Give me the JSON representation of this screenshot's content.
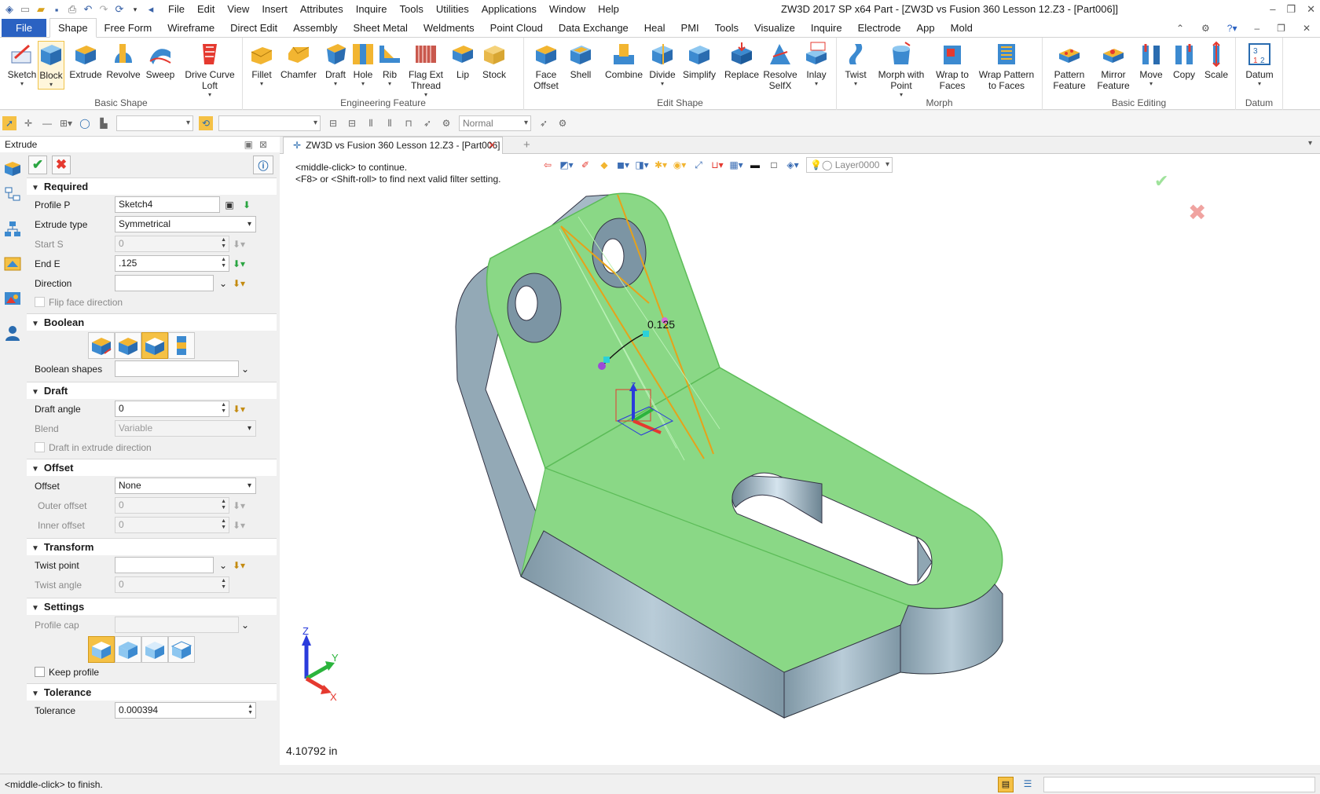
{
  "title_bar": {
    "menus": [
      "File",
      "Edit",
      "View",
      "Insert",
      "Attributes",
      "Inquire",
      "Tools",
      "Utilities",
      "Applications",
      "Window",
      "Help"
    ],
    "window_title": "ZW3D 2017 SP x64        Part - [ZW3D vs Fusion 360 Lesson 12.Z3 - [Part006]]"
  },
  "ribbon_tabs": [
    "Shape",
    "Free Form",
    "Wireframe",
    "Direct Edit",
    "Assembly",
    "Sheet Metal",
    "Weldments",
    "Point Cloud",
    "Data Exchange",
    "Heal",
    "PMI",
    "Tools",
    "Visualize",
    "Inquire",
    "Electrode",
    "App",
    "Mold"
  ],
  "file_tab": "File",
  "ribbon_groups": {
    "basic_shape": {
      "label": "Basic Shape",
      "buttons": [
        {
          "l1": "Sketch",
          "l2": ""
        },
        {
          "l1": "Block",
          "l2": ""
        },
        {
          "l1": "Extrude",
          "l2": ""
        },
        {
          "l1": "Revolve",
          "l2": ""
        },
        {
          "l1": "Sweep",
          "l2": ""
        },
        {
          "l1": "Drive Curve",
          "l2": "Loft"
        }
      ]
    },
    "engineering_feature": {
      "label": "Engineering Feature",
      "buttons": [
        {
          "l1": "Fillet",
          "l2": ""
        },
        {
          "l1": "Chamfer",
          "l2": ""
        },
        {
          "l1": "Draft",
          "l2": ""
        },
        {
          "l1": "Hole",
          "l2": ""
        },
        {
          "l1": "Rib",
          "l2": ""
        },
        {
          "l1": "Flag Ext",
          "l2": "Thread"
        },
        {
          "l1": "Lip",
          "l2": ""
        },
        {
          "l1": "Stock",
          "l2": ""
        }
      ]
    },
    "edit_shape": {
      "label": "Edit Shape",
      "buttons": [
        {
          "l1": "Face",
          "l2": "Offset"
        },
        {
          "l1": "Shell",
          "l2": ""
        },
        {
          "l1": "Combine",
          "l2": ""
        },
        {
          "l1": "Divide",
          "l2": ""
        },
        {
          "l1": "Simplify",
          "l2": ""
        },
        {
          "l1": "Replace",
          "l2": ""
        },
        {
          "l1": "Resolve",
          "l2": "SelfX"
        },
        {
          "l1": "Inlay",
          "l2": ""
        }
      ]
    },
    "morph": {
      "label": "Morph",
      "buttons": [
        {
          "l1": "Twist",
          "l2": ""
        },
        {
          "l1": "Morph with",
          "l2": "Point"
        },
        {
          "l1": "Wrap to",
          "l2": "Faces"
        },
        {
          "l1": "Wrap Pattern",
          "l2": "to Faces"
        }
      ]
    },
    "basic_editing": {
      "label": "Basic Editing",
      "buttons": [
        {
          "l1": "Pattern",
          "l2": "Feature"
        },
        {
          "l1": "Mirror",
          "l2": "Feature"
        },
        {
          "l1": "Move",
          "l2": ""
        },
        {
          "l1": "Copy",
          "l2": ""
        },
        {
          "l1": "Scale",
          "l2": ""
        }
      ]
    },
    "datum": {
      "label": "Datum",
      "buttons": [
        {
          "l1": "Datum",
          "l2": ""
        }
      ]
    }
  },
  "toolbar2": {
    "render_mode": "Normal"
  },
  "panel": {
    "title": "Extrude",
    "required": {
      "header": "Required",
      "profile_label": "Profile P",
      "profile_value": "Sketch4",
      "extrude_type_label": "Extrude type",
      "extrude_type_value": "Symmetrical",
      "start_label": "Start S",
      "start_value": "0",
      "end_label": "End E",
      "end_value": ".125",
      "direction_label": "Direction",
      "direction_value": "",
      "flip_label": "Flip face direction"
    },
    "boolean": {
      "header": "Boolean",
      "shapes_label": "Boolean shapes",
      "shapes_value": ""
    },
    "draft": {
      "header": "Draft",
      "angle_label": "Draft angle",
      "angle_value": "0",
      "blend_label": "Blend",
      "blend_value": "Variable",
      "dir_label": "Draft in extrude direction"
    },
    "offset": {
      "header": "Offset",
      "offset_label": "Offset",
      "offset_value": "None",
      "outer_label": "Outer offset",
      "outer_value": "0",
      "inner_label": "Inner offset",
      "inner_value": "0"
    },
    "transform": {
      "header": "Transform",
      "twist_point_label": "Twist point",
      "twist_point_value": "",
      "twist_angle_label": "Twist angle",
      "twist_angle_value": "0"
    },
    "settings": {
      "header": "Settings",
      "profile_cap_label": "Profile cap",
      "profile_cap_value": "",
      "keep_label": "Keep profile"
    },
    "tolerance": {
      "header": "Tolerance",
      "tolerance_label": "Tolerance",
      "tolerance_value": "0.000394"
    }
  },
  "doc_tab": "ZW3D vs Fusion 360 Lesson 12.Z3 - [Part006]",
  "viewport": {
    "layer": "Layer0000",
    "hint1": "<middle-click> to continue.",
    "hint2": "<F8> or <Shift-roll> to find next valid filter setting.",
    "dim_value": "0.125",
    "coord_readout": "4.10792 in",
    "axis_x": "X",
    "axis_y": "Y",
    "axis_z": "Z"
  },
  "status": {
    "message": "<middle-click> to finish."
  },
  "colors": {
    "accent": "#2b62c2",
    "selected_face": "#8ad886",
    "body": "#9fb3c0",
    "selected_bool": "#f5c145"
  }
}
